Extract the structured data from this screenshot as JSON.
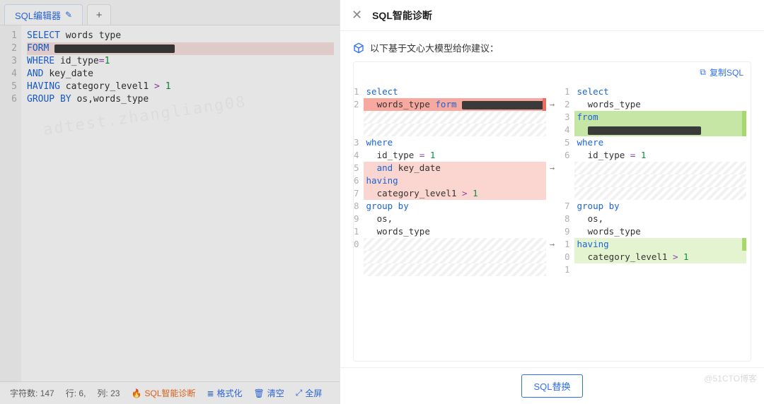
{
  "editor": {
    "tab_label": "SQL编辑器",
    "add_tab": "+",
    "lines": [
      {
        "n": 1,
        "tokens": [
          [
            "kw",
            "SELECT"
          ],
          [
            "sp",
            " "
          ],
          [
            "id",
            "words type"
          ]
        ]
      },
      {
        "n": 2,
        "error": true,
        "tokens": [
          [
            "kw",
            "FORM"
          ],
          [
            "sp",
            " "
          ],
          [
            "blur",
            170
          ]
        ]
      },
      {
        "n": 3,
        "tokens": [
          [
            "kw",
            "WHERE"
          ],
          [
            "sp",
            " "
          ],
          [
            "id",
            "id_type"
          ],
          [
            "op",
            "="
          ],
          [
            "num",
            "1"
          ]
        ]
      },
      {
        "n": 4,
        "tokens": [
          [
            "kw",
            "AND"
          ],
          [
            "sp",
            " "
          ],
          [
            "id",
            "key_date"
          ]
        ]
      },
      {
        "n": 5,
        "tokens": [
          [
            "kw",
            "HAVING"
          ],
          [
            "sp",
            " "
          ],
          [
            "id",
            "category_level1"
          ],
          [
            "sp",
            " "
          ],
          [
            "op",
            ">"
          ],
          [
            "sp",
            " "
          ],
          [
            "num",
            "1"
          ]
        ]
      },
      {
        "n": 6,
        "tokens": [
          [
            "kw",
            "GROUP BY"
          ],
          [
            "sp",
            " "
          ],
          [
            "id",
            "os,words_type"
          ]
        ]
      }
    ],
    "status": {
      "chars_label": "字符数:",
      "chars": "147",
      "row_label": "行:",
      "row": "6,",
      "col_label": "列:",
      "col": "23",
      "diag": "SQL智能诊断",
      "format": "格式化",
      "clear": "清空",
      "fullscreen": "全屏"
    }
  },
  "panel": {
    "title": "SQL智能诊断",
    "suggestion_intro": "以下基于文心大模型给你建议：",
    "copy_sql_label": "复制SQL",
    "replace_btn": "SQL替换",
    "left": [
      {
        "n": "1",
        "cls": "",
        "tokens": [
          [
            "kw",
            "select"
          ]
        ]
      },
      {
        "n": "2",
        "cls": "del-strong",
        "mark": "red",
        "tokens": [
          [
            "sp",
            "  "
          ],
          [
            "id",
            "words_type"
          ],
          [
            "sp",
            " "
          ],
          [
            "kw",
            "form"
          ],
          [
            "sp",
            " "
          ],
          [
            "blur",
            120
          ]
        ]
      },
      {
        "n": "",
        "cls": "hatch",
        "tokens": []
      },
      {
        "n": "",
        "cls": "hatch",
        "tokens": []
      },
      {
        "n": "3",
        "cls": "",
        "tokens": [
          [
            "kw",
            "where"
          ]
        ]
      },
      {
        "n": "4",
        "cls": "",
        "tokens": [
          [
            "sp",
            "  "
          ],
          [
            "id",
            "id_type"
          ],
          [
            "sp",
            " "
          ],
          [
            "op",
            "="
          ],
          [
            "sp",
            " "
          ],
          [
            "num",
            "1"
          ]
        ]
      },
      {
        "n": "5",
        "cls": "del-soft",
        "tokens": [
          [
            "sp",
            "  "
          ],
          [
            "kw",
            "and"
          ],
          [
            "sp",
            " "
          ],
          [
            "id",
            "key_date"
          ]
        ]
      },
      {
        "n": "6",
        "cls": "del-soft",
        "tokens": [
          [
            "kw",
            "having"
          ]
        ]
      },
      {
        "n": "7",
        "cls": "del-soft",
        "tokens": [
          [
            "sp",
            "  "
          ],
          [
            "id",
            "category_level1"
          ],
          [
            "sp",
            " "
          ],
          [
            "op",
            ">"
          ],
          [
            "sp",
            " "
          ],
          [
            "num",
            "1"
          ]
        ]
      },
      {
        "n": "8",
        "cls": "",
        "tokens": [
          [
            "kw",
            "group by"
          ]
        ]
      },
      {
        "n": "9",
        "cls": "",
        "tokens": [
          [
            "sp",
            "  "
          ],
          [
            "id",
            "os,"
          ]
        ]
      },
      {
        "n": "1",
        "cls": "",
        "tokens": [
          [
            "sp",
            "  "
          ],
          [
            "id",
            "words_type"
          ]
        ]
      },
      {
        "n": "0",
        "cls": "hatch",
        "tokens": []
      },
      {
        "n": "",
        "cls": "hatch",
        "tokens": []
      },
      {
        "n": "",
        "cls": "hatch",
        "tokens": []
      }
    ],
    "arrows": [
      "",
      "→",
      "",
      "",
      "",
      "",
      "→",
      "",
      "",
      "",
      "",
      "",
      "→",
      "",
      ""
    ],
    "right": [
      {
        "n": "1",
        "cls": "",
        "tokens": [
          [
            "kw",
            "select"
          ]
        ]
      },
      {
        "n": "2",
        "cls": "",
        "tokens": [
          [
            "sp",
            "  "
          ],
          [
            "id",
            "words_type"
          ]
        ]
      },
      {
        "n": "3",
        "cls": "add-strong",
        "mark": "grn",
        "tokens": [
          [
            "kw",
            "from"
          ]
        ]
      },
      {
        "n": "4",
        "cls": "add-strong",
        "mark": "grn",
        "tokens": [
          [
            "sp",
            "  "
          ],
          [
            "blur",
            160
          ]
        ]
      },
      {
        "n": "5",
        "cls": "",
        "tokens": [
          [
            "kw",
            "where"
          ]
        ]
      },
      {
        "n": "6",
        "cls": "",
        "tokens": [
          [
            "sp",
            "  "
          ],
          [
            "id",
            "id_type"
          ],
          [
            "sp",
            " "
          ],
          [
            "op",
            "="
          ],
          [
            "sp",
            " "
          ],
          [
            "num",
            "1"
          ]
        ]
      },
      {
        "n": "",
        "cls": "hatch",
        "tokens": []
      },
      {
        "n": "",
        "cls": "hatch",
        "tokens": []
      },
      {
        "n": "",
        "cls": "hatch",
        "tokens": []
      },
      {
        "n": "7",
        "cls": "",
        "tokens": [
          [
            "kw",
            "group by"
          ]
        ]
      },
      {
        "n": "8",
        "cls": "",
        "tokens": [
          [
            "sp",
            "  "
          ],
          [
            "id",
            "os,"
          ]
        ]
      },
      {
        "n": "9",
        "cls": "",
        "tokens": [
          [
            "sp",
            "  "
          ],
          [
            "id",
            "words_type"
          ]
        ]
      },
      {
        "n": "1",
        "cls": "add-soft",
        "mark": "grn",
        "tokens": [
          [
            "kw",
            "having"
          ]
        ]
      },
      {
        "n": "0",
        "cls": "add-soft",
        "tokens": [
          [
            "sp",
            "  "
          ],
          [
            "id",
            "category_level1"
          ],
          [
            "sp",
            " "
          ],
          [
            "op",
            ">"
          ],
          [
            "sp",
            " "
          ],
          [
            "num",
            "1"
          ]
        ]
      },
      {
        "n": "1",
        "cls": "",
        "tokens": []
      }
    ]
  },
  "brand_watermark": "@51CTO博客"
}
